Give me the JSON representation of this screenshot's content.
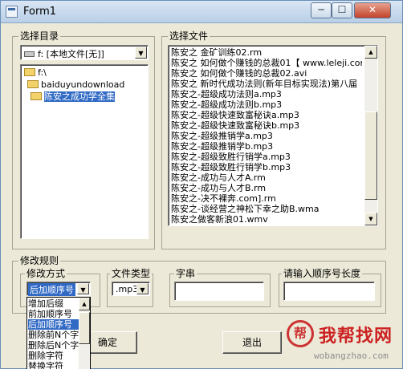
{
  "window": {
    "title": "Form1",
    "buttons": {
      "minimize": "─",
      "maximize": "☐",
      "close": "✕"
    }
  },
  "dir_group": {
    "label": "选择目录",
    "drive_value": "f: [本地文件[无]]",
    "tree": [
      "f:\\",
      "baiduyundownload",
      "陈安之成功学全集"
    ],
    "selected_index": 2
  },
  "file_group": {
    "label": "选择文件",
    "files": [
      "陈安之 金矿训练02.rm",
      "陈安之 如何做个赚钱的总裁01【 www.leleji.com",
      "陈安之 如何做个赚钱的总裁02.avi",
      "陈安之 新时代成功法则(新年目标实现法)第八届",
      "陈安之-超级成功法则a.mp3",
      "陈安之-超级成功法则b.mp3",
      "陈安之-超级快速致富秘诀a.mp3",
      "陈安之-超级快速致富秘诀b.mp3",
      "陈安之-超级推销学a.mp3",
      "陈安之-超级推销学b.mp3",
      "陈安之-超级致胜行销学a.mp3",
      "陈安之-超级致胜行销学b.mp3",
      "陈安之-成功与人才A.rm",
      "陈安之-成功与人才B.rm",
      "陈安之-决不裸奔.com].rm",
      "陈安之-谈经营之神松下幸之助B.wma",
      "陈安之做客新浪01.wmv"
    ]
  },
  "rules_group": {
    "label": "修改规则",
    "method": {
      "label": "修改方式",
      "value": "后加顺序号",
      "options": [
        "增加后缀",
        "前加顺序号",
        "后加顺序号",
        "删除前N个字",
        "删除后N个字",
        "删除字符",
        "替换字符"
      ],
      "highlighted_index": 2
    },
    "filetype": {
      "label": "文件类型",
      "value": ".mp3"
    },
    "string": {
      "label": "字串",
      "value": ""
    },
    "seq_length": {
      "label": "请输入顺序号长度",
      "value": ""
    }
  },
  "actions": {
    "ok": "确定",
    "exit": "退出"
  },
  "watermark": {
    "mark": "帮",
    "text": "我帮找网",
    "url": "wobangzhao.com"
  }
}
